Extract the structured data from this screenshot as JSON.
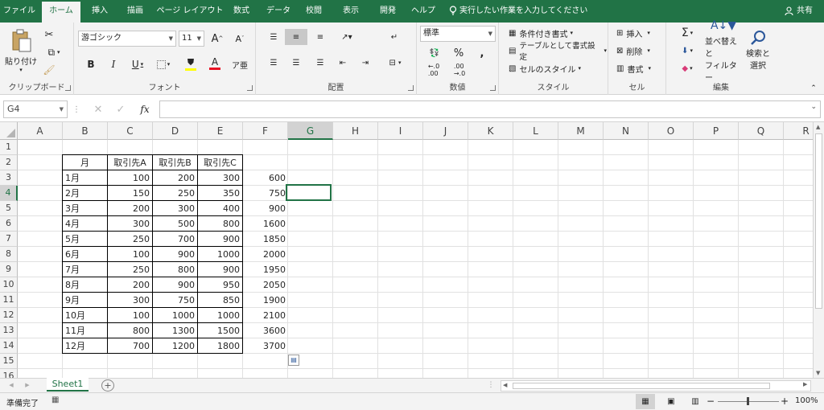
{
  "menu": {
    "tabs": [
      "ファイル",
      "ホーム",
      "挿入",
      "描画",
      "ページ レイアウト",
      "数式",
      "データ",
      "校閲",
      "表示",
      "開発",
      "ヘルプ"
    ],
    "tell_me": "実行したい作業を入力してください",
    "share": "共有"
  },
  "ribbon": {
    "clipboard": {
      "label": "クリップボード",
      "paste": "貼り付け"
    },
    "font": {
      "label": "フォント",
      "font_name": "游ゴシック",
      "font_size": "11"
    },
    "alignment": {
      "label": "配置"
    },
    "number": {
      "label": "数値",
      "format": "標準"
    },
    "styles": {
      "label": "スタイル",
      "conditional": "条件付き書式",
      "as_table": "テーブルとして書式設定",
      "cell_styles": "セルのスタイル"
    },
    "cells": {
      "label": "セル",
      "insert": "挿入",
      "delete": "削除",
      "format": "書式"
    },
    "editing": {
      "label": "編集",
      "sort_1": "並べ替えと",
      "sort_2": "フィルター",
      "find_1": "検索と",
      "find_2": "選択"
    }
  },
  "formula_bar": {
    "name_box": "G4",
    "content": ""
  },
  "grid": {
    "columns": [
      "A",
      "B",
      "C",
      "D",
      "E",
      "F",
      "G",
      "H",
      "I",
      "J",
      "K",
      "L",
      "M",
      "N",
      "O",
      "P",
      "Q",
      "R"
    ],
    "rows": [
      "1",
      "2",
      "3",
      "4",
      "5",
      "6",
      "7",
      "8",
      "9",
      "10",
      "11",
      "12",
      "13",
      "14",
      "15",
      "16"
    ],
    "selected_cell": "G4",
    "header": [
      "月",
      "取引先A",
      "取引先B",
      "取引先C"
    ],
    "data": [
      {
        "month": "1月",
        "a": "100",
        "b": "200",
        "c": "300",
        "total": "600"
      },
      {
        "month": "2月",
        "a": "150",
        "b": "250",
        "c": "350",
        "total": "750"
      },
      {
        "month": "3月",
        "a": "200",
        "b": "300",
        "c": "400",
        "total": "900"
      },
      {
        "month": "4月",
        "a": "300",
        "b": "500",
        "c": "800",
        "total": "1600"
      },
      {
        "month": "5月",
        "a": "250",
        "b": "700",
        "c": "900",
        "total": "1850"
      },
      {
        "month": "6月",
        "a": "100",
        "b": "900",
        "c": "1000",
        "total": "2000"
      },
      {
        "month": "7月",
        "a": "250",
        "b": "800",
        "c": "900",
        "total": "1950"
      },
      {
        "month": "8月",
        "a": "200",
        "b": "900",
        "c": "950",
        "total": "2050"
      },
      {
        "month": "9月",
        "a": "300",
        "b": "750",
        "c": "850",
        "total": "1900"
      },
      {
        "month": "10月",
        "a": "100",
        "b": "1000",
        "c": "1000",
        "total": "2100"
      },
      {
        "month": "11月",
        "a": "800",
        "b": "1300",
        "c": "1500",
        "total": "3600"
      },
      {
        "month": "12月",
        "a": "700",
        "b": "1200",
        "c": "1800",
        "total": "3700"
      }
    ]
  },
  "sheets": {
    "active": "Sheet1"
  },
  "status": {
    "ready": "準備完了",
    "zoom": "100%"
  },
  "colors": {
    "accent": "#217346",
    "ribbon_bg": "#f3f3f3",
    "font_color_bar": "#e81123",
    "fill_color_bar": "#ffff00"
  }
}
